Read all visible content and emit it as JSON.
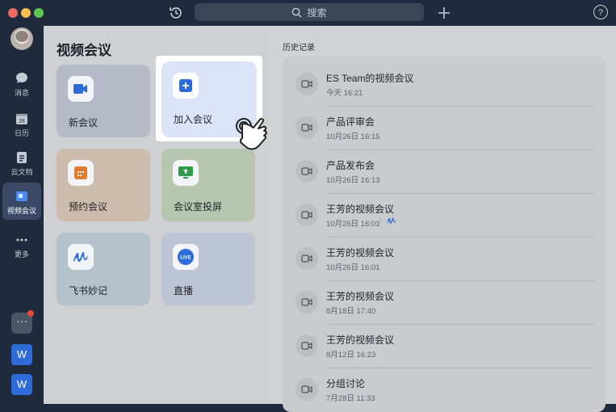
{
  "topbar": {
    "search_placeholder": "搜索",
    "help_label": "?"
  },
  "sidebar": {
    "items": [
      {
        "label": "消息",
        "icon": "chat-bubble-icon"
      },
      {
        "label": "日历",
        "icon": "calendar-icon",
        "badge": "28"
      },
      {
        "label": "云文档",
        "icon": "cloud-doc-icon"
      },
      {
        "label": "视频会议",
        "icon": "video-meeting-icon",
        "active": true
      },
      {
        "label": "更多",
        "icon": "more-dots-icon"
      }
    ],
    "dock": [
      {
        "label": "W",
        "icon": "word-app-icon"
      },
      {
        "label": "W",
        "icon": "word-app-icon"
      }
    ]
  },
  "main": {
    "title": "视频会议",
    "cards": [
      {
        "label": "新会议",
        "icon": "video-camera-icon"
      },
      {
        "label": "加入会议",
        "icon": "plus-square-icon"
      },
      {
        "label": "预约会议",
        "icon": "calendar-grid-icon"
      },
      {
        "label": "会议室投屏",
        "icon": "screen-share-icon"
      },
      {
        "label": "飞书妙记",
        "icon": "minutes-logo-icon"
      },
      {
        "label": "直播",
        "icon": "live-icon",
        "icon_text": "LIVE"
      }
    ]
  },
  "history": {
    "title": "历史记录",
    "items": [
      {
        "name": "ES Team的视频会议",
        "time": "今天 16:21"
      },
      {
        "name": "产品评审会",
        "time": "10月26日 16:15"
      },
      {
        "name": "产品发布会",
        "time": "10月26日 16:13"
      },
      {
        "name": "王芳的视频会议",
        "time": "10月26日 16:01",
        "has_minutes": true
      },
      {
        "name": "王芳的视频会议",
        "time": "10月26日 16:01"
      },
      {
        "name": "王芳的视频会议",
        "time": "8月18日 17:40"
      },
      {
        "name": "王芳的视频会议",
        "time": "8月12日 16:23"
      },
      {
        "name": "分组讨论",
        "time": "7月28日 11:33"
      }
    ]
  },
  "colors": {
    "accent_blue": "#2d6bd8",
    "sidebar_bg": "#1f2a3c"
  }
}
